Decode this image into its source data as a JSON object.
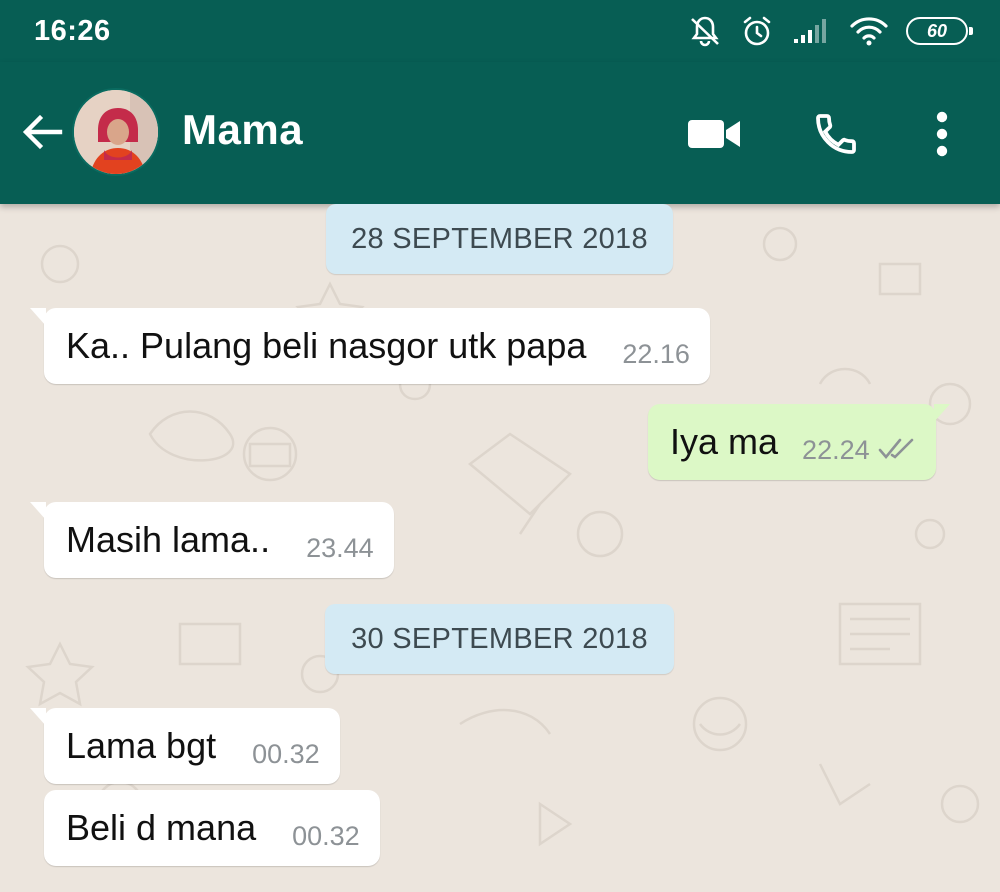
{
  "status_bar": {
    "time": "16:26",
    "battery": "60",
    "icons": [
      "mute-notifications-icon",
      "alarm-icon",
      "signal-icon",
      "wifi-icon",
      "battery-icon"
    ]
  },
  "app_bar": {
    "contact_name": "Mama",
    "icons": [
      "back-arrow-icon",
      "video-call-icon",
      "phone-icon",
      "more-vert-icon"
    ]
  },
  "colors": {
    "header": "#075e54",
    "chat_background": "#ece5dd",
    "outgoing_bubble": "#dcf8c6",
    "incoming_bubble": "#ffffff",
    "date_chip": "#d4eaf4",
    "read_ticks": "#8d9296"
  },
  "chat": {
    "dates": [
      "28 SEPTEMBER 2018",
      "30 SEPTEMBER 2018"
    ],
    "messages": [
      {
        "direction": "in",
        "text": "Ka.. Pulang beli nasgor utk papa",
        "time": "22.16"
      },
      {
        "direction": "out",
        "text": "Iya ma",
        "time": "22.24",
        "status": "delivered"
      },
      {
        "direction": "in",
        "text": "Masih lama..",
        "time": "23.44"
      },
      {
        "direction": "in",
        "text": "Lama bgt",
        "time": "00.32"
      },
      {
        "direction": "in",
        "text": "Beli d mana",
        "time": "00.32"
      }
    ]
  }
}
